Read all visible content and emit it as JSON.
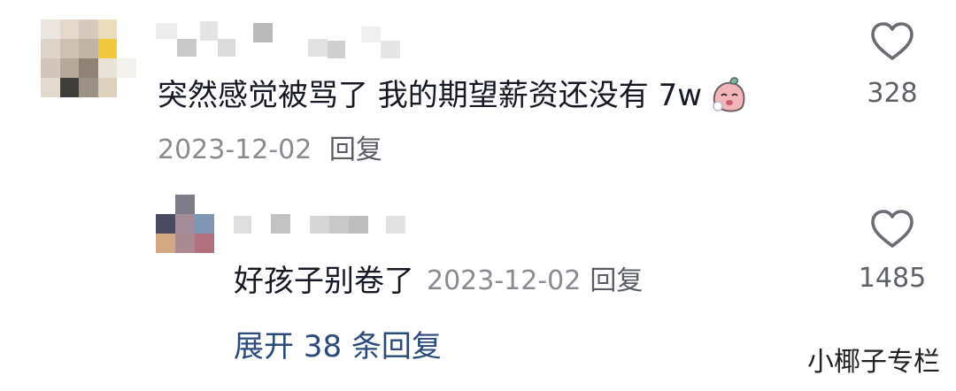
{
  "comments": [
    {
      "text": "突然感觉被骂了 我的期望薪资还没有 7w",
      "date": "2023-12-02",
      "reply_label": "回复",
      "like_count": "328",
      "emoji": "crying-face-emoji",
      "like_icon": "heart-outline-icon"
    }
  ],
  "replies": [
    {
      "text": "好孩子别卷了",
      "date": "2023-12-02",
      "reply_label": "回复",
      "like_count": "1485",
      "like_icon": "heart-outline-icon"
    }
  ],
  "expand_replies": {
    "label": "展开 38 条回复"
  },
  "watermark": "小椰子专栏",
  "colors": {
    "text": "#161823",
    "meta": "#8a8b91",
    "link": "#2a4a7c"
  }
}
